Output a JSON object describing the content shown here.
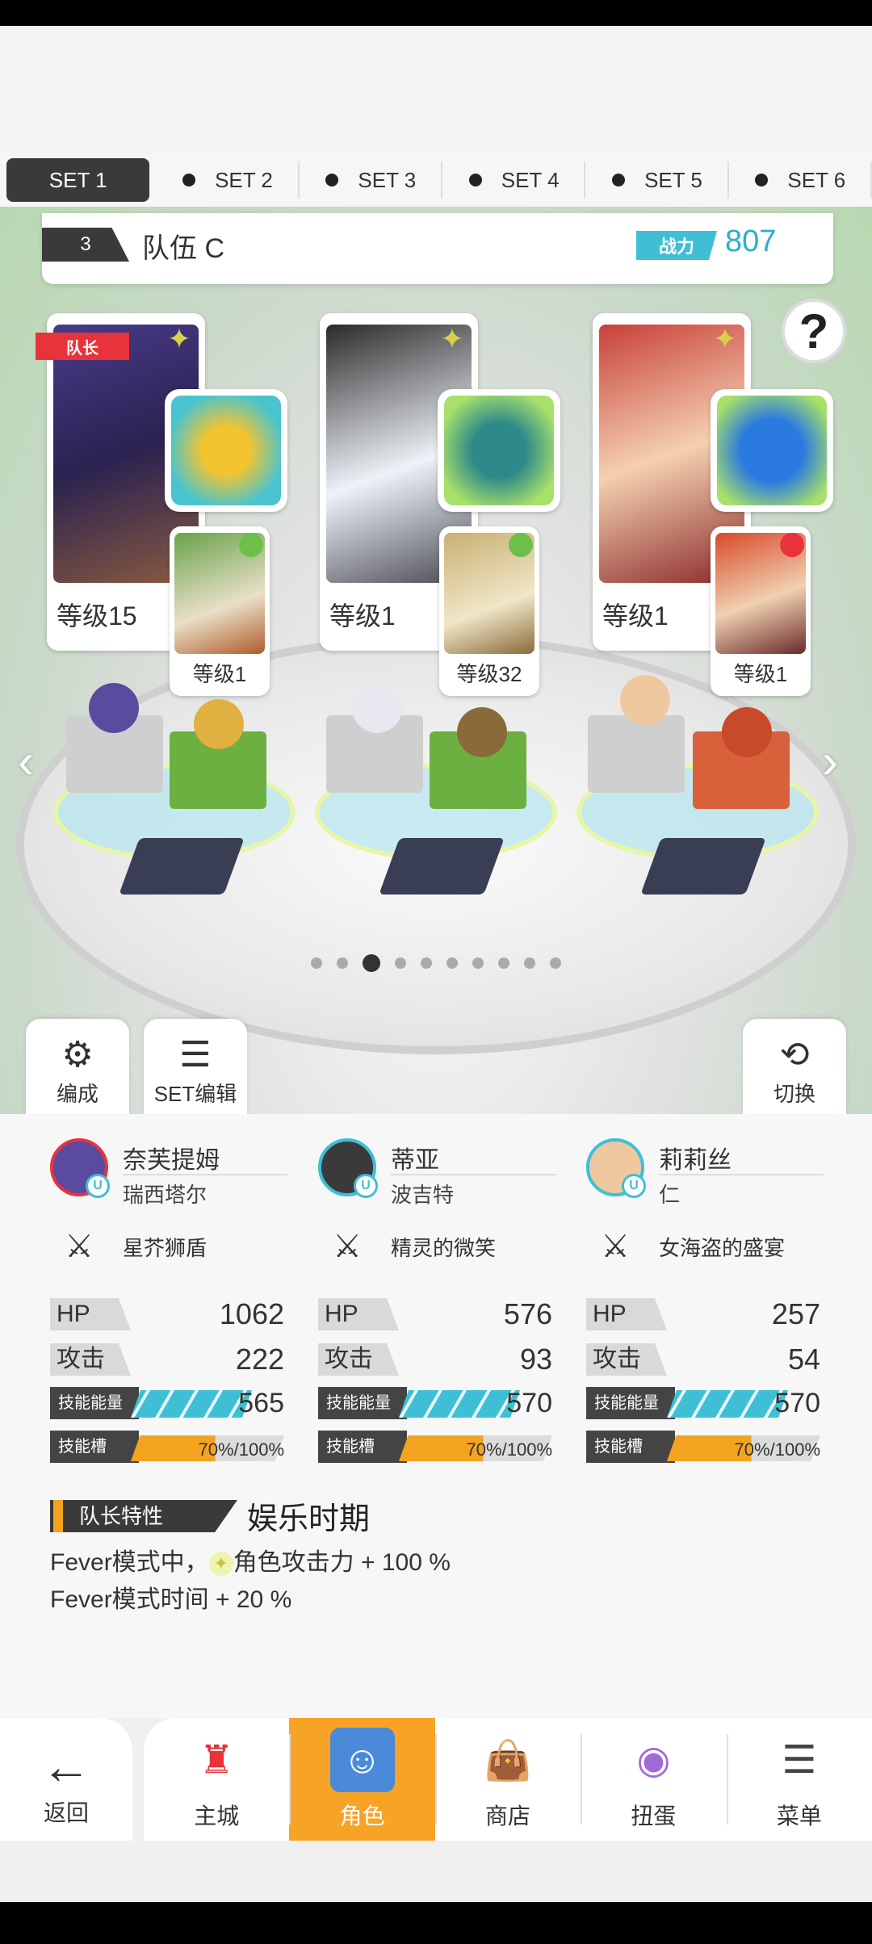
{
  "set_tabs": [
    "SET 1",
    "SET 2",
    "SET 3",
    "SET 4",
    "SET 5",
    "SET 6"
  ],
  "team": {
    "number": "3",
    "name": "队伍 C",
    "power_label": "战力",
    "power_value": "807"
  },
  "leader_tag": "队长",
  "help": "?",
  "characters": [
    {
      "level": "等级15",
      "pet_level": "等级1"
    },
    {
      "level": "等级1",
      "pet_level": "等级32"
    },
    {
      "level": "等级1",
      "pet_level": "等级1"
    }
  ],
  "buttons": {
    "formation": "编成",
    "set_edit": "SET编辑",
    "switch": "切换"
  },
  "members": [
    {
      "name": "奈芙提姆",
      "sub": "瑞西塔尔",
      "weapon": "星芥狮盾",
      "hp": "1062",
      "atk": "222",
      "skill_energy": "565",
      "skill_slot": "70",
      "skill_slot_max": "100"
    },
    {
      "name": "蒂亚",
      "sub": "波吉特",
      "weapon": "精灵的微笑",
      "hp": "576",
      "atk": "93",
      "skill_energy": "570",
      "skill_slot": "70",
      "skill_slot_max": "100"
    },
    {
      "name": "莉莉丝",
      "sub": "仁",
      "weapon": "女海盗的盛宴",
      "hp": "257",
      "atk": "54",
      "skill_energy": "570",
      "skill_slot": "70",
      "skill_slot_max": "100"
    }
  ],
  "stat_labels": {
    "hp": "HP",
    "atk": "攻击",
    "energy": "技能能量",
    "slot": "技能槽",
    "pct": "%",
    "slash": "/"
  },
  "leader_trait": {
    "label": "队长特性",
    "name": "娱乐时期",
    "line1_prefix": "Fever模式中，",
    "line1_suffix": "角色攻击力 + 100 %",
    "line2": "Fever模式时间 + 20 %"
  },
  "nav": {
    "back": "返回",
    "items": [
      "主城",
      "角色",
      "商店",
      "扭蛋",
      "菜单"
    ],
    "active": "角色"
  },
  "colors": {
    "accent": "#f7a326",
    "power": "#3ebfd6",
    "leader_red": "#e8333a"
  }
}
